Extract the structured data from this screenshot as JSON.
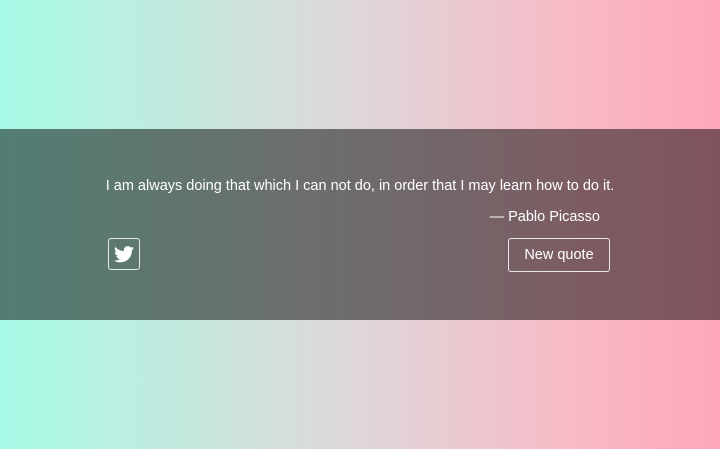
{
  "quote": {
    "text": "I am always doing that which I can not do, in order that I may learn how to do it.",
    "author": "— Pablo Picasso"
  },
  "actions": {
    "tweet_icon": "twitter-bird-icon",
    "new_quote_label": "New quote"
  },
  "colors": {
    "gradient_left": "#a6fbe6",
    "gradient_right": "#ffa7ba",
    "overlay": "rgba(0,0,0,0.5)",
    "text": "#ffffff"
  }
}
